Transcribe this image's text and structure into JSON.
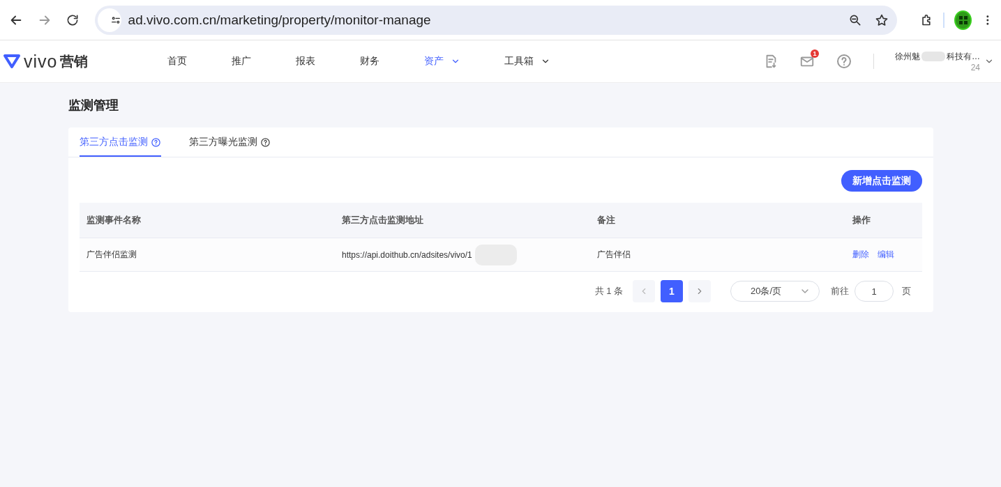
{
  "browser": {
    "url": "ad.vivo.com.cn/marketing/property/monitor-manage"
  },
  "header": {
    "logo_word": "vivo",
    "logo_suffix": "营销",
    "nav": [
      {
        "label": "首页",
        "selected": false,
        "dropdown": false
      },
      {
        "label": "推广",
        "selected": false,
        "dropdown": false
      },
      {
        "label": "报表",
        "selected": false,
        "dropdown": false
      },
      {
        "label": "财务",
        "selected": false,
        "dropdown": false
      },
      {
        "label": "资产",
        "selected": true,
        "dropdown": true
      },
      {
        "label": "工具箱",
        "selected": false,
        "dropdown": true
      }
    ],
    "mail_badge": "1",
    "account_name_start": "徐州魅",
    "account_name_end": "科技有…",
    "account_id_end": "24"
  },
  "page_title": "监测管理",
  "tabs": [
    {
      "label": "第三方点击监测",
      "selected": true
    },
    {
      "label": "第三方曝光监测",
      "selected": false
    }
  ],
  "add_button": "新增点击监测",
  "table": {
    "columns": [
      "监测事件名称",
      "第三方点击监测地址",
      "备注",
      "操作"
    ],
    "rows": [
      {
        "name": "广告伴侣监测",
        "url": "https://api.doithub.cn/adsites/vivo/1",
        "note": "广告伴侣",
        "actions": [
          "删除",
          "编辑"
        ]
      }
    ]
  },
  "pagination": {
    "total": "共 1 条",
    "pages": [
      {
        "label": "1",
        "selected": true
      }
    ],
    "page_size": "20条/页",
    "goto_label": "前往",
    "goto_value": "1",
    "goto_suffix": "页"
  }
}
